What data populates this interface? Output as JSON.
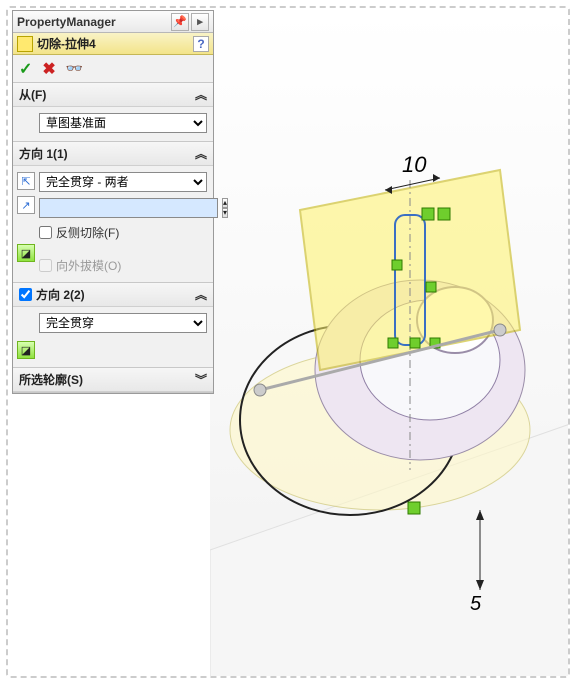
{
  "pm": {
    "title": "PropertyManager"
  },
  "feature": {
    "name": "切除-拉伸4"
  },
  "actions": {
    "ok": "✓",
    "cancel": "✖",
    "preview": "👓"
  },
  "from": {
    "title": "从(F)",
    "value": "草图基准面"
  },
  "dir1": {
    "title": "方向 1(1)",
    "end_condition": "完全贯穿 - 两者",
    "distance": "",
    "flip_label": "反侧切除(F)",
    "draft_label": "向外拔模(O)"
  },
  "dir2": {
    "title": "方向 2(2)",
    "enabled": true,
    "end_condition": "完全贯穿"
  },
  "contours": {
    "title": "所选轮廓(S)"
  },
  "viewport": {
    "dim1": "10",
    "dim2": "5"
  }
}
